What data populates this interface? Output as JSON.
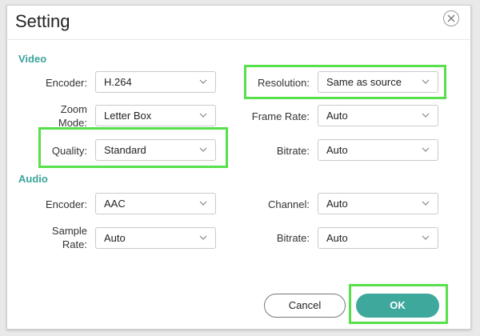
{
  "dialog": {
    "title": "Setting"
  },
  "video": {
    "heading": "Video",
    "encoder": {
      "label": "Encoder:",
      "value": "H.264"
    },
    "zoom_mode": {
      "label_line1": "Zoom",
      "label_line2": "Mode:",
      "value": "Letter Box"
    },
    "quality": {
      "label": "Quality:",
      "value": "Standard"
    },
    "resolution": {
      "label": "Resolution:",
      "value": "Same as source"
    },
    "frame_rate": {
      "label": "Frame Rate:",
      "value": "Auto"
    },
    "bitrate": {
      "label": "Bitrate:",
      "value": "Auto"
    }
  },
  "audio": {
    "heading": "Audio",
    "encoder": {
      "label": "Encoder:",
      "value": "AAC"
    },
    "sample_rate": {
      "label_line1": "Sample",
      "label_line2": "Rate:",
      "value": "Auto"
    },
    "channel": {
      "label": "Channel:",
      "value": "Auto"
    },
    "bitrate": {
      "label": "Bitrate:",
      "value": "Auto"
    }
  },
  "buttons": {
    "cancel": "Cancel",
    "ok": "OK"
  },
  "colors": {
    "accent": "#3fa89d",
    "highlight": "#57e04a",
    "section": "#3aa39b"
  }
}
